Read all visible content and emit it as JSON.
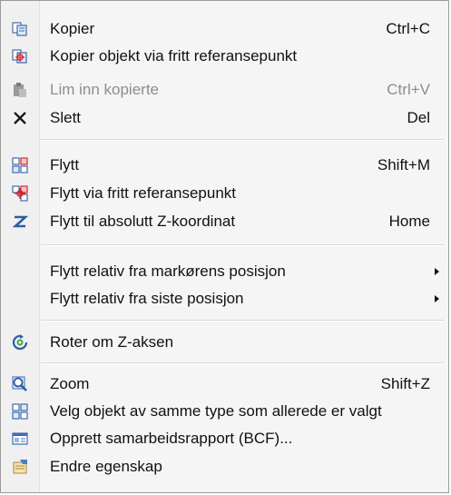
{
  "menu": {
    "items": [
      {
        "label": "Kopier",
        "shortcut": "Ctrl+C",
        "icon": "copy-icon"
      },
      {
        "label": "Kopier objekt via fritt referansepunkt",
        "shortcut": "",
        "icon": "copy-reference-icon"
      },
      {
        "label": "Lim inn kopierte",
        "shortcut": "Ctrl+V",
        "icon": "paste-icon",
        "disabled": true
      },
      {
        "label": "Slett",
        "shortcut": "Del",
        "icon": "delete-x-icon"
      },
      {
        "label": "Flytt",
        "shortcut": "Shift+M",
        "icon": "move-icon"
      },
      {
        "label": "Flytt via fritt referansepunkt",
        "shortcut": "",
        "icon": "move-reference-icon"
      },
      {
        "label": "Flytt til absolutt Z-koordinat",
        "shortcut": "Home",
        "icon": "z-icon"
      },
      {
        "label": "Flytt relativ fra markørens posisjon",
        "submenu": true
      },
      {
        "label": "Flytt relativ fra siste posisjon",
        "submenu": true
      },
      {
        "label": "Roter om Z-aksen",
        "shortcut": "",
        "icon": "rotate-z-icon"
      },
      {
        "label": "Zoom",
        "shortcut": "Shift+Z",
        "icon": "zoom-icon"
      },
      {
        "label": "Velg objekt av samme type som allerede er valgt",
        "shortcut": "",
        "icon": "select-same-type-icon"
      },
      {
        "label": "Opprett samarbeidsrapport (BCF)...",
        "shortcut": "",
        "icon": "bcf-report-icon"
      },
      {
        "label": "Endre egenskap",
        "shortcut": "",
        "icon": "properties-icon"
      }
    ]
  }
}
